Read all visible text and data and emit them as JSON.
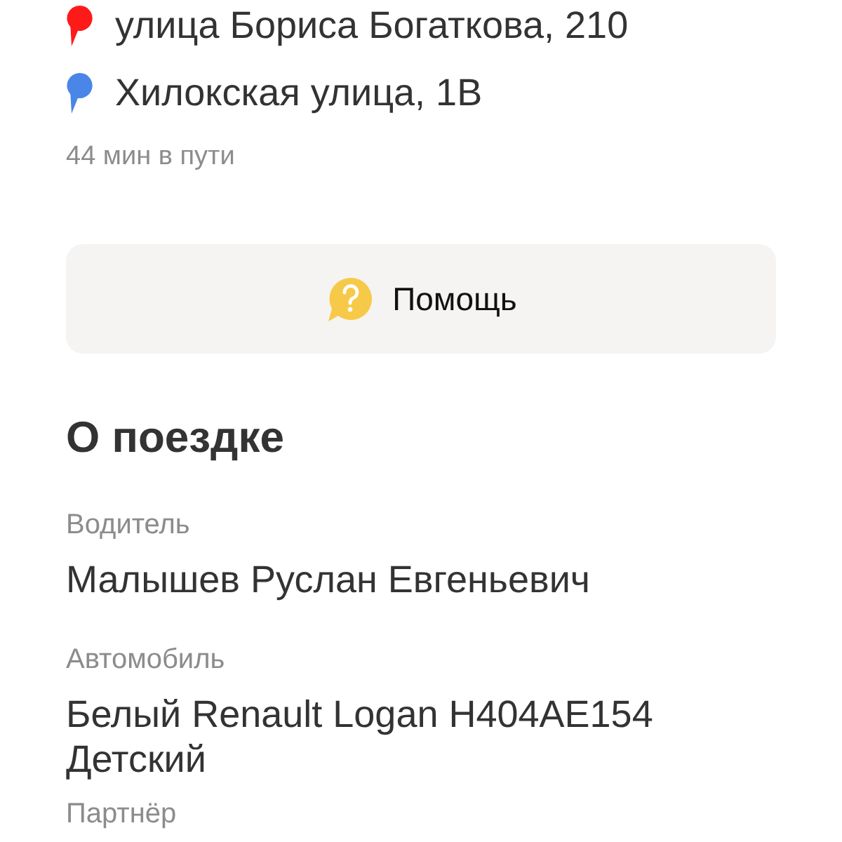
{
  "route": {
    "stops": [
      {
        "address": "улица Бориса Богаткова, 210",
        "color": "#ff1a1a"
      },
      {
        "address": "Хилокская улица, 1В",
        "color": "#4a86e8"
      }
    ],
    "duration": "44 мин в пути"
  },
  "help_button": {
    "label": "Помощь"
  },
  "trip_info": {
    "title": "О поездке",
    "fields": [
      {
        "label": "Водитель",
        "value": "Малышев Руслан Евгеньевич"
      },
      {
        "label": "Автомобиль",
        "value": "Белый Renault Logan Н404АЕ154 Детский"
      },
      {
        "label": "Партнёр"
      }
    ]
  }
}
